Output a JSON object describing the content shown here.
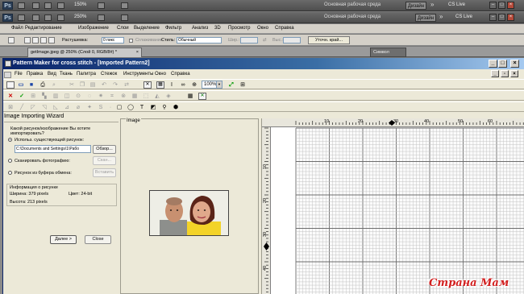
{
  "ps": {
    "logo": "Ps",
    "zoom_a": "150%",
    "zoom_b": "250%",
    "workspace": "Основная рабочая среда",
    "design": "Дизайн",
    "more": "»",
    "cslive": "CS Live",
    "menu": [
      "Файл",
      "Редактирование",
      "Изображение",
      "Слои",
      "Выделение",
      "Фильтр",
      "Анализ",
      "3D",
      "Просмотр",
      "Окно",
      "Справка"
    ],
    "opts": {
      "feather_label": "Растушевка:",
      "feather_value": "0 пикс",
      "antialias_label": "Сглаживание",
      "style_label": "Стиль:",
      "style_value": "Обычный",
      "w_label": "Шир.:",
      "h_label": "Выс.:",
      "refine": "Уточн. край..."
    },
    "doc_tab": "getImage.jpeg @ 250% (Слой 0, RGB/8#) *",
    "doc_tab_close": "×",
    "panel_tab": "Символ"
  },
  "pm": {
    "title": "Pattern Maker for cross stitch - [Imported Pattern2]",
    "menu": [
      "File",
      "Правка",
      "Вид",
      "Ткань",
      "Палитра",
      "Стежок",
      "Инструменты",
      "Окно",
      "Справка"
    ],
    "zoom": "100%",
    "wizard": {
      "title": "Image Importing Wizard",
      "question": "Какой рисунок/изображение Вы хотите импортировать?",
      "opt_existing": "Использ. существующий рисунок:",
      "path": "C:\\Documents and Settings\\1\\Рабо",
      "browse": "Обзор...",
      "opt_scan": "Сканировать фотографию:",
      "scan_btn": "Скан...",
      "opt_clipboard": "Рисунок из буфера обмена:",
      "paste_btn": "Вставить",
      "info_title": "Информация о рисунке",
      "width": "Ширина:  379 pixels",
      "height": "Высота:  213 pixels",
      "color": "Цвет:   24-bit",
      "next": "Далее >",
      "close": "Close"
    },
    "image_label": "Image",
    "ruler": {
      "h": [
        "10",
        "20",
        "30",
        "40",
        "50",
        "60"
      ],
      "v": [
        "10",
        "20",
        "30",
        "40"
      ]
    }
  },
  "watermark": "Страна Мам"
}
